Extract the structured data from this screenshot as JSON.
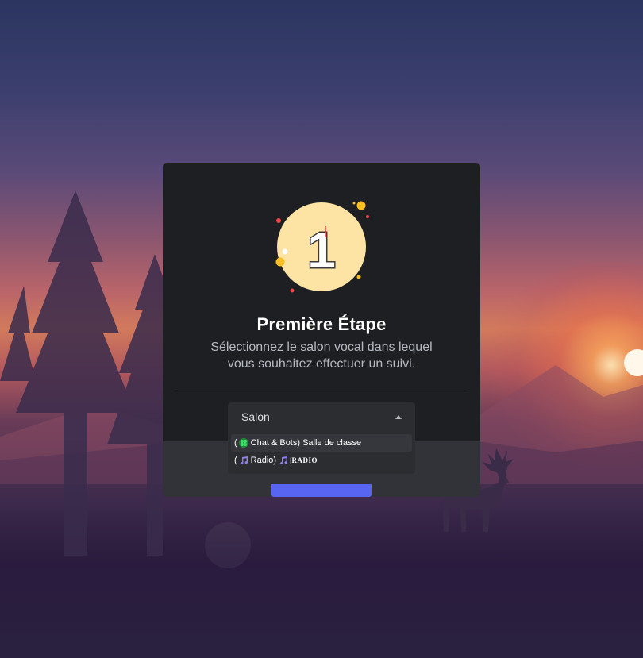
{
  "modal": {
    "step_number": "1",
    "title": "Première Étape",
    "subtitle_line1": "Sélectionnez le salon vocal dans lequel",
    "subtitle_line2": "vous souhaitez effectuer un suivi."
  },
  "select": {
    "placeholder": "Salon",
    "options": [
      {
        "prefix": "(",
        "icon": "four-leaf-clover-icon",
        "text": "Chat & Bots) Salle de classe",
        "suffix": ""
      },
      {
        "prefix": "(",
        "icon": "music-note-icon",
        "text": "Radio)",
        "suffix_icon": "music-note-icon",
        "suffix": "|RADIO"
      }
    ]
  },
  "colors": {
    "card": "#1e1f22",
    "footer": "#313338",
    "accent": "#5865f2",
    "badge": "#fde3a4"
  }
}
